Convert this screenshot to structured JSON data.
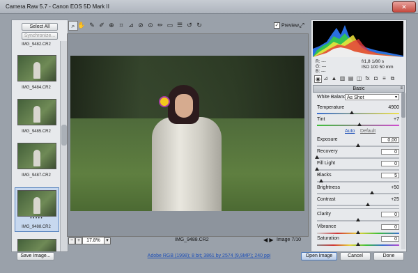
{
  "window": {
    "title": "Camera Raw 5.7  -  Canon EOS 5D Mark II",
    "close_label": "✕"
  },
  "filmstrip": {
    "select_all": "Select All",
    "synchronize": "Synchronize...",
    "items": [
      {
        "caption": "IMG_9482.CR2"
      },
      {
        "caption": "IMG_9484.CR2"
      },
      {
        "caption": "IMG_9485.CR2"
      },
      {
        "caption": "IMG_9487.CR2"
      },
      {
        "caption": "IMG_9488.CR2",
        "rating": "• • • • •",
        "selected": true
      }
    ]
  },
  "toolbar": {
    "tools": [
      "zoom-icon",
      "hand-icon",
      "white-balance-icon",
      "color-sampler-icon",
      "target-adjust-icon",
      "crop-icon",
      "straighten-icon",
      "spot-removal-icon",
      "red-eye-icon",
      "adjustment-brush-icon",
      "graduated-filter-icon",
      "preferences-icon",
      "rotate-left-icon",
      "rotate-right-icon"
    ],
    "preview_label": "Preview",
    "preview_checked": "✓"
  },
  "statusbar": {
    "minus": "−",
    "plus": "+",
    "zoom": "17.8%",
    "zoom_arrow": "▾",
    "filename": "IMG_9488.CR2",
    "image_count": "Image 7/10"
  },
  "histogram_info": {
    "r_label": "R:  ---",
    "g_label": "G:  ---",
    "b_label": "B:  ---",
    "aperture_shutter": "f/1,8     1/80 s",
    "iso_focal": "ISO 100     50 mm"
  },
  "panel": {
    "title": "Basic",
    "menu": "≡",
    "white_balance_label": "White Balance:",
    "white_balance_value": "As Shot",
    "temperature_label": "Temperature",
    "temperature_value": "4900",
    "tint_label": "Tint",
    "tint_value": "+7",
    "auto": "Auto",
    "default": "Default",
    "exposure_label": "Exposure",
    "exposure_value": "0,00",
    "recovery_label": "Recovery",
    "recovery_value": "0",
    "fill_light_label": "Fill Light",
    "fill_light_value": "0",
    "blacks_label": "Blacks",
    "blacks_value": "5",
    "brightness_label": "Brightness",
    "brightness_value": "+50",
    "contrast_label": "Contrast",
    "contrast_value": "+25",
    "clarity_label": "Clarity",
    "clarity_value": "0",
    "vibrance_label": "Vibrance",
    "vibrance_value": "0",
    "saturation_label": "Saturation",
    "saturation_value": "0"
  },
  "bottom": {
    "save_image": "Save Image...",
    "workflow": "Adobe RGB (1998); 8 bit; 3861 by 2574 (9,9MP); 240 ppi",
    "open_image": "Open Image",
    "cancel": "Cancel",
    "done": "Done"
  },
  "colors": {
    "accent": "#1d4fb7",
    "selection": "#c7d8ef"
  }
}
